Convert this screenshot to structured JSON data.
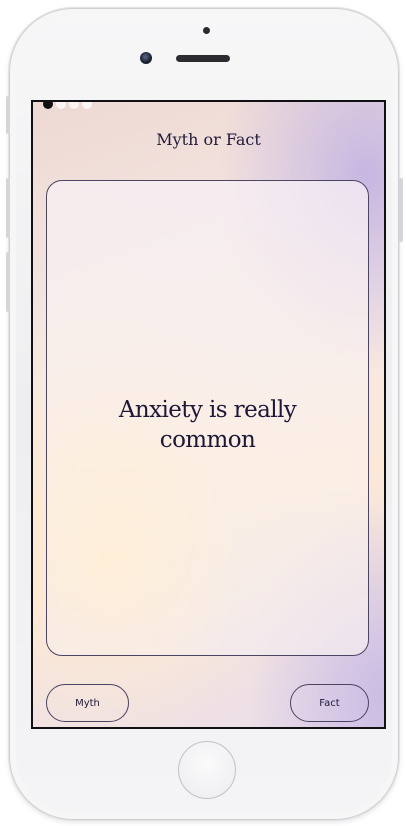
{
  "screen": {
    "title": "Myth or Fact",
    "progress": {
      "total": 4,
      "current": 1
    }
  },
  "card": {
    "statement": "Anxiety is really common"
  },
  "answers": {
    "myth_label": "Myth",
    "fact_label": "Fact"
  },
  "colors": {
    "text": "#1d1838",
    "border": "#4a4563",
    "gradient_warm": "#fbe8d8",
    "gradient_lavender": "#c4b4e2"
  }
}
